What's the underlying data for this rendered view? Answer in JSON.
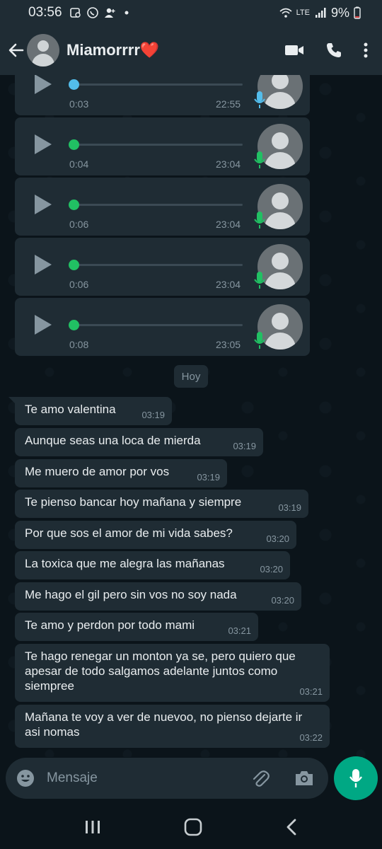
{
  "status_bar": {
    "time": "03:56",
    "battery": "9%",
    "lte": "LTE"
  },
  "header": {
    "contact_name": "Miamorrrr❤️"
  },
  "voice_notes": [
    {
      "duration": "0:03",
      "time": "22:55",
      "played": false
    },
    {
      "duration": "0:04",
      "time": "23:04",
      "played": true
    },
    {
      "duration": "0:06",
      "time": "23:04",
      "played": true
    },
    {
      "duration": "0:06",
      "time": "23:04",
      "played": true
    },
    {
      "duration": "0:08",
      "time": "23:05",
      "played": true
    }
  ],
  "day_chip": "Hoy",
  "messages": [
    {
      "text": "Te amo valentina",
      "time": "03:19"
    },
    {
      "text": "Aunque seas una loca de mierda",
      "time": "03:19"
    },
    {
      "text": "Me muero de amor por vos",
      "time": "03:19"
    },
    {
      "text": "Te pienso bancar hoy mañana y siempre",
      "time": "03:19"
    },
    {
      "text": "Por que sos el amor de mi vida sabes?",
      "time": "03:20"
    },
    {
      "text": "La toxica que me alegra las mañanas",
      "time": "03:20"
    },
    {
      "text": "Me hago el gil pero sin vos no soy nada",
      "time": "03:20"
    },
    {
      "text": "Te amo y perdon por todo mami",
      "time": "03:21"
    },
    {
      "text": "Te hago renegar un monton ya se, pero quiero que apesar de todo salgamos adelante juntos como siempree",
      "time": "03:21"
    },
    {
      "text": "Mañana te voy a ver de nuevoo, no pienso dejarte ir asi nomas",
      "time": "03:22"
    }
  ],
  "composer": {
    "placeholder": "Mensaje"
  },
  "colors": {
    "accent": "#00a884",
    "bubble": "#1f2c34",
    "played_dot": "#21c063",
    "unplayed_dot": "#53bdeb",
    "background": "#0b141a"
  }
}
